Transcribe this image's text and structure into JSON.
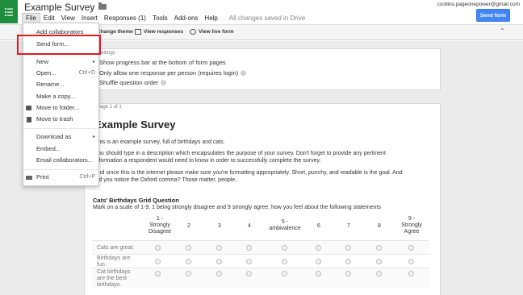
{
  "header": {
    "title": "Example Survey",
    "user_email": "ccollins.pageonepower@gmail.com",
    "send_button": "Send form",
    "saved_status": "All changes saved in Drive",
    "menus": [
      "File",
      "Edit",
      "View",
      "Insert",
      "Responses (1)",
      "Tools",
      "Add-ons",
      "Help"
    ]
  },
  "toolbar": {
    "theme": "Change theme",
    "view_responses": "View responses",
    "view_live": "View live form"
  },
  "file_menu": {
    "items": [
      {
        "label": "Add collaborators"
      },
      {
        "label": "Send form..."
      },
      {
        "label": "New",
        "submenu": true
      },
      {
        "label": "Open...",
        "shortcut": "Ctrl+O"
      },
      {
        "label": "Rename..."
      },
      {
        "label": "Make a copy..."
      },
      {
        "label": "Move to folder..."
      },
      {
        "label": "Move to trash"
      },
      {
        "label": "Download as",
        "submenu": true
      },
      {
        "label": "Embed..."
      },
      {
        "label": "Email collaborators..."
      },
      {
        "label": "Print",
        "shortcut": "Ctrl+P"
      }
    ],
    "submenu_arrow": "▸"
  },
  "settings": {
    "label": "Settings",
    "options": [
      {
        "label": "Show progress bar at the bottom of form pages"
      },
      {
        "label": "Only allow one response per person (requires login)"
      },
      {
        "label": "Shuffle question order"
      }
    ],
    "help_glyph": "?"
  },
  "survey": {
    "page_label": "Page 1 of 1",
    "title": "Example Survey",
    "desc1": "This is an example survey, full of birthdays and cats.",
    "desc2a": "You should type in a description which encapsulates the purpose of your survey. Don't forget to provide any pertinent",
    "desc2b": "information a respondent would need to know in order to successfully complete the survey.",
    "desc3a": "And since this is the internet please make sure you're formatting appropriately. Short, punchy, and readable is the goal. And",
    "desc3b": "did you notice the Oxford comma? Those matter, people.",
    "question_title": "Cats' Birthdays Grid Question",
    "question_help": "Mark on a scale of 1-9, 1 being strongly disagree and 9 strongly agree, how you feel about the following statements",
    "columns": [
      [
        "1 -",
        "Strongly",
        "Disagree"
      ],
      [
        "2"
      ],
      [
        "3"
      ],
      [
        "4"
      ],
      [
        "5 -",
        "ambivalence"
      ],
      [
        "6"
      ],
      [
        "7"
      ],
      [
        "8"
      ],
      [
        "9 -",
        "Strongly",
        "Agree"
      ]
    ],
    "rows": [
      [
        "Cats are great."
      ],
      [
        "Birthdays are",
        "fun."
      ],
      [
        "Cat birthdays",
        "are the best",
        "birthdays."
      ]
    ]
  },
  "colors": {
    "accent": "#4285f4",
    "app_green": "#1e8e3e",
    "highlight_red": "#e01b22"
  }
}
